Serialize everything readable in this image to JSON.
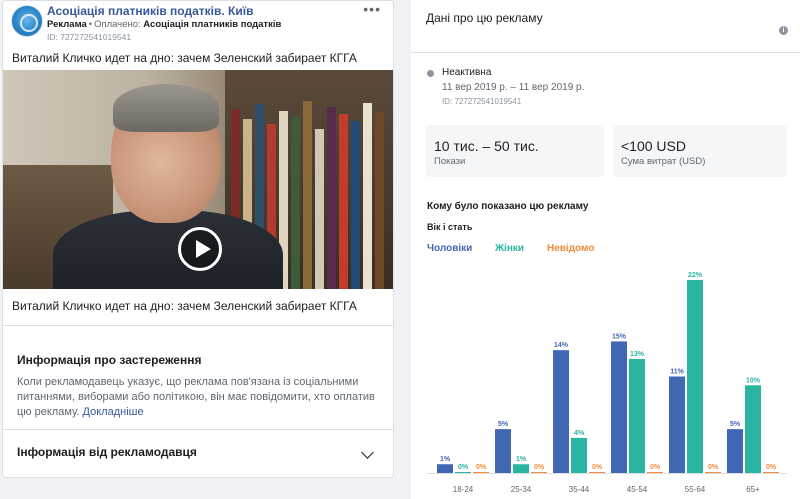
{
  "post": {
    "page_name": "Асоціація платників податків. Київ",
    "sponsored_label": "Реклама",
    "paid_prefix": "Оплачено:",
    "paid_by": "Асоціація платників податків",
    "ad_id": "ID: 727272541019541",
    "more_icon": "more-dots-icon",
    "text": "Виталий Кличко идет на дно: зачем Зеленский забирает КГГА",
    "video_caption": "Виталий Кличко идет на дно: зачем Зеленский забирает КГГА",
    "play_icon": "play-icon"
  },
  "disclaimer": {
    "title": "Информація про застереження",
    "body": "Коли рекламодавець указує, що реклама пов'язана із соціальними питаннями, виборами або політикою, він має повідомити, хто оплатив цю рекламу.",
    "link": "Докладніше"
  },
  "advertiser": {
    "title": "Інформація від рекламодавця",
    "chevron_icon": "chevron-down-icon"
  },
  "details": {
    "title": "Дані про цю рекламу",
    "info_icon": "info-icon",
    "status": "Неактивна",
    "dates": "11 вер 2019 р. – 11 вер 2019 р.",
    "ad_id": "ID: 727272541019541",
    "impressions_value": "10 тис. – 50 тис.",
    "impressions_label": "Покази",
    "spend_value": "<100 USD",
    "spend_label": "Сума витрат (USD)",
    "who_title": "Кому було показано цю рекламу",
    "age_sex_tab": "Вік і стать"
  },
  "chart_data": {
    "type": "bar",
    "categories": [
      "18-24",
      "25-34",
      "35-44",
      "45-54",
      "55-64",
      "65+"
    ],
    "series": [
      {
        "name": "Чоловіки",
        "color": "#4267b2",
        "values": [
          1,
          5,
          14,
          15,
          11,
          5
        ],
        "labels": [
          "1%",
          "5%",
          "14%",
          "15%",
          "11%",
          "5%"
        ]
      },
      {
        "name": "Жінки",
        "color": "#2ab5a3",
        "values": [
          0,
          1,
          4,
          13,
          22,
          10
        ],
        "labels": [
          "0%",
          "1%",
          "4%",
          "13%",
          "22%",
          "10%"
        ]
      },
      {
        "name": "Невідомо",
        "color": "#f28b3c",
        "values": [
          0,
          0,
          0,
          0,
          0,
          0
        ],
        "labels": [
          "0%",
          "0%",
          "0%",
          "0%",
          "0%",
          "0%"
        ]
      }
    ],
    "ylim": [
      0,
      22
    ],
    "grid": false,
    "legend": "top-left"
  }
}
